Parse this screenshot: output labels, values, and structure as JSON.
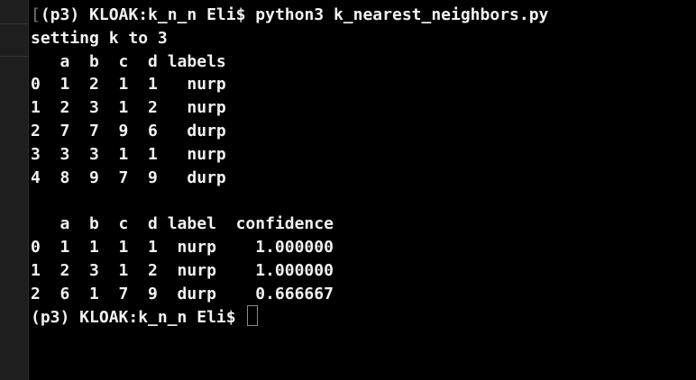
{
  "theme": {
    "background": "#000000",
    "text": "#f2f2f2",
    "gutter": "#1e1e1e",
    "cursor_border": "#8a8a8a"
  },
  "terminal": {
    "mark_glyph": "[",
    "prompt": "(p3) KLOAK:k_n_n Eli$ ",
    "command": "python3 k_nearest_neighbors.py",
    "status_line": "setting k to 3",
    "training_table": {
      "header": "   a  b  c  d labels",
      "rows": [
        "0  1  2  1  1   nurp",
        "1  2  3  1  2   nurp",
        "2  7  7  9  6   durp",
        "3  3  3  1  1   nurp",
        "4  8  9  7  9   durp"
      ]
    },
    "result_table": {
      "header": "   a  b  c  d label  confidence",
      "rows": [
        "0  1  1  1  1  nurp    1.000000",
        "1  2  3  1  2  nurp    1.000000",
        "2  6  1  7  9  durp    0.666667"
      ]
    },
    "final_prompt": "(p3) KLOAK:k_n_n Eli$ "
  }
}
